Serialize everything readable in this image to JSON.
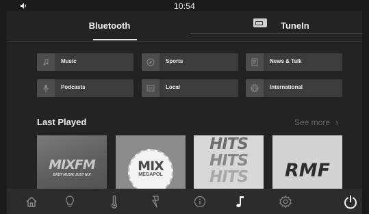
{
  "status": {
    "time": "10:54",
    "volume_icon": "speaker-icon"
  },
  "tabs": [
    {
      "label": "Bluetooth",
      "active": true
    },
    {
      "label": "TuneIn",
      "active": false,
      "icon": "radio-card-icon"
    }
  ],
  "categories": [
    {
      "label": "Music",
      "icon": "music-note-icon"
    },
    {
      "label": "Sports",
      "icon": "compass-icon"
    },
    {
      "label": "News & Talk",
      "icon": "document-icon"
    },
    {
      "label": "Podcasts",
      "icon": "microphone-icon"
    },
    {
      "label": "Local",
      "icon": "local-icon"
    },
    {
      "label": "International",
      "icon": "globe-icon"
    }
  ],
  "last_played": {
    "title": "Last Played",
    "see_more": "See more",
    "stations": [
      {
        "logo": "MIXFM",
        "tagline": "BÄST MUSIK JUST NU!"
      },
      {
        "logo": "MIX",
        "sub": "MEGAPOL"
      },
      {
        "logo": [
          "HITS",
          "HITS",
          "HITS"
        ]
      },
      {
        "logo": "RMF"
      }
    ]
  },
  "dock": [
    {
      "icon": "home-icon",
      "active": false
    },
    {
      "icon": "lightbulb-icon",
      "active": false
    },
    {
      "icon": "thermometer-icon",
      "active": false
    },
    {
      "icon": "charging-icon",
      "active": false
    },
    {
      "icon": "info-icon",
      "active": false
    },
    {
      "icon": "music-note-icon",
      "active": true
    },
    {
      "icon": "settings-gear-icon",
      "active": false
    },
    {
      "icon": "power-icon",
      "active": false
    }
  ],
  "colors": {
    "background": "#1b1b1b",
    "panel": "#232323",
    "chip": "#3c3c3c",
    "dock": "#2c2c2c",
    "text": "#f2f2f2",
    "muted": "#6a6a6a"
  }
}
